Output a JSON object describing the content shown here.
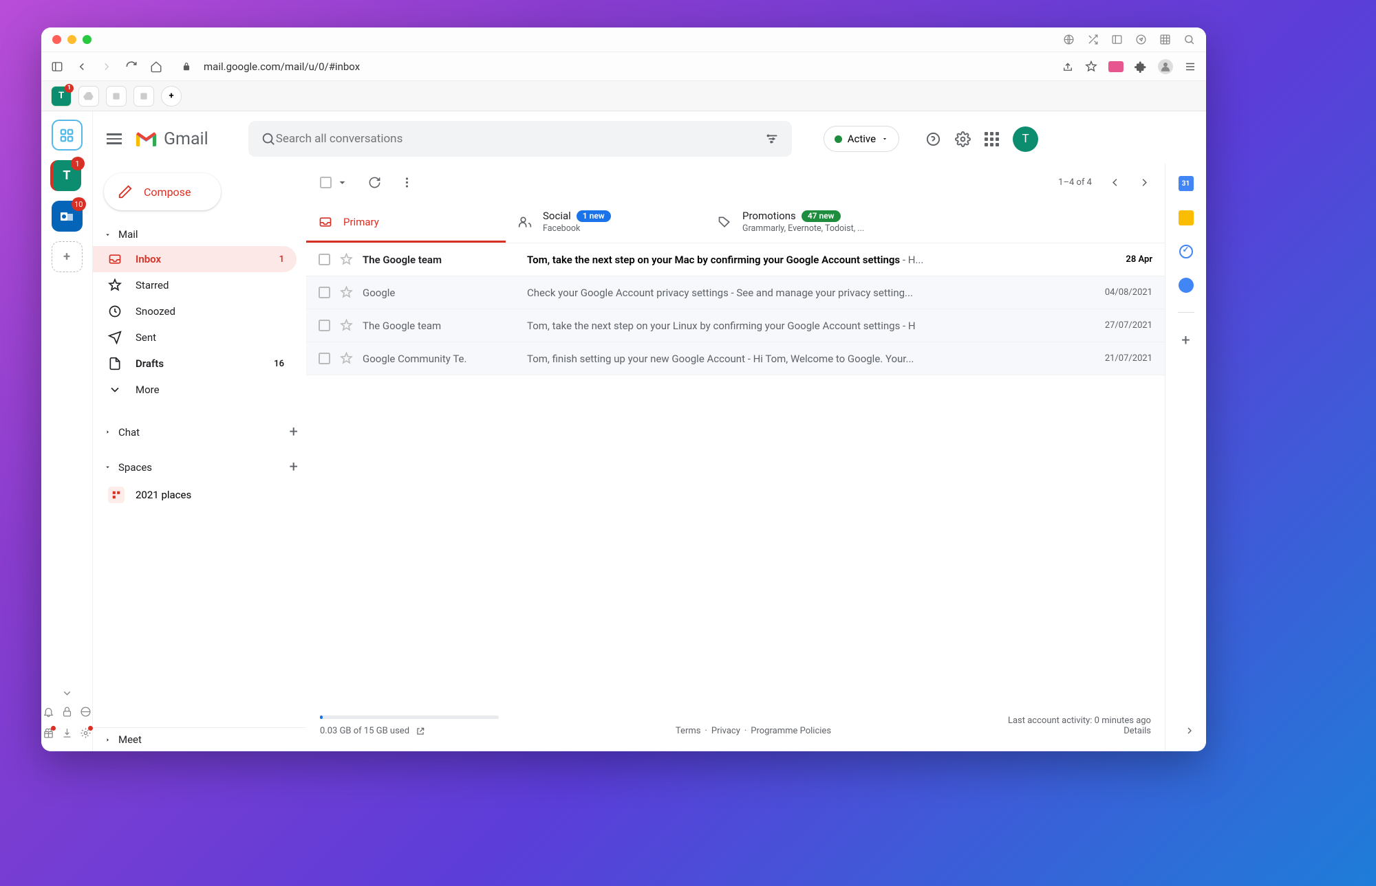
{
  "browser": {
    "url": "mail.google.com/mail/u/0/#inbox"
  },
  "tabstrip": {
    "active_letter": "T",
    "active_badge": "1"
  },
  "left_rail": {
    "teal_letter": "T",
    "teal_badge": "1",
    "outlook_badge": "10"
  },
  "gmail": {
    "logo_text": "Gmail",
    "search_placeholder": "Search all conversations",
    "status": "Active",
    "avatar_letter": "T"
  },
  "compose": "Compose",
  "sections": {
    "mail": "Mail",
    "chat": "Chat",
    "spaces": "Spaces",
    "meet": "Meet"
  },
  "nav": {
    "inbox": {
      "label": "Inbox",
      "count": "1"
    },
    "starred": "Starred",
    "snoozed": "Snoozed",
    "sent": "Sent",
    "drafts": {
      "label": "Drafts",
      "count": "16"
    },
    "more": "More"
  },
  "space_item": "2021 places",
  "toolbar": {
    "range": "1–4 of 4"
  },
  "tabs": {
    "primary": "Primary",
    "social": {
      "label": "Social",
      "badge": "1 new",
      "sub": "Facebook"
    },
    "promotions": {
      "label": "Promotions",
      "badge": "47 new",
      "sub": "Grammarly, Evernote, Todoist, ..."
    }
  },
  "emails": [
    {
      "sender": "The Google team",
      "subject": "Tom, take the next step on your Mac by confirming your Google Account settings",
      "snippet": " - H...",
      "date": "28 Apr",
      "unread": true
    },
    {
      "sender": "Google",
      "subject": "Check your Google Account privacy settings",
      "snippet": " - See and manage your privacy setting...",
      "date": "04/08/2021",
      "unread": false
    },
    {
      "sender": "The Google team",
      "subject": "Tom, take the next step on your Linux by confirming your Google Account settings",
      "snippet": " - H",
      "date": "27/07/2021",
      "unread": false
    },
    {
      "sender": "Google Community Te.",
      "subject": "Tom, finish setting up your new Google Account",
      "snippet": " - Hi Tom, Welcome to Google. Your...",
      "date": "21/07/2021",
      "unread": false
    }
  ],
  "footer": {
    "storage": "0.03 GB of 15 GB used",
    "terms": "Terms",
    "privacy": "Privacy",
    "policies": "Programme Policies",
    "activity": "Last account activity: 0 minutes ago",
    "details": "Details"
  },
  "calendar_day": "31"
}
